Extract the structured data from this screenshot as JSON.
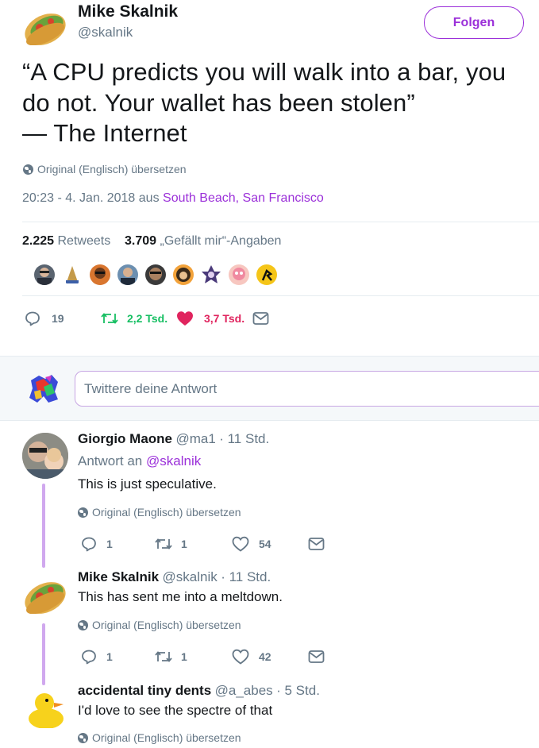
{
  "tweet": {
    "name": "Mike Skalnik",
    "handle": "@skalnik",
    "follow_label": "Folgen",
    "text": "“A CPU predicts you will walk into a bar, you do not. Your wallet has been stolen”\n— The Internet",
    "translate_label": "Original (Englisch) übersetzen",
    "time_prefix": "20:23 - 4. Jan. 2018 aus ",
    "location": "South Beach, San Francisco",
    "retweets_count": "2.225",
    "retweets_label": "Retweets",
    "likes_count": "3.709",
    "likes_label": "„Gefällt mir“-Angaben",
    "reply_count": "19",
    "retweet_action_count": "2,2 Tsd.",
    "like_action_count": "3,7 Tsd."
  },
  "liker_avatars": [
    "user-avatar",
    "user-avatar",
    "user-avatar",
    "user-avatar",
    "user-avatar",
    "user-avatar",
    "user-avatar",
    "user-avatar",
    "user-avatar"
  ],
  "reply_composer": {
    "placeholder": "Twittere deine Antwort"
  },
  "replies": [
    {
      "name": "Giorgio Maone",
      "handle": "@ma1",
      "time": "· 11 Std.",
      "reply_to_prefix": "Antwort an ",
      "reply_to": "@skalnik",
      "text": "This is just speculative.",
      "translate_label": "Original (Englisch) übersetzen",
      "reply_count": "1",
      "retweet_count": "1",
      "like_count": "54"
    },
    {
      "name": "Mike Skalnik",
      "handle": "@skalnik",
      "time": "· 11 Std.",
      "text": "This has sent me into a meltdown.",
      "translate_label": "Original (Englisch) übersetzen",
      "reply_count": "1",
      "retweet_count": "1",
      "like_count": "42"
    },
    {
      "name": "accidental tiny dents",
      "handle": "@a_abes",
      "time": "· 5 Std.",
      "text": "I'd love to see the spectre of that",
      "translate_label": "Original (Englisch) übersetzen"
    }
  ],
  "colors": {
    "accent": "#9b30d9",
    "retweet_green": "#17bf63",
    "like_red": "#e0245e",
    "muted": "#657786"
  }
}
